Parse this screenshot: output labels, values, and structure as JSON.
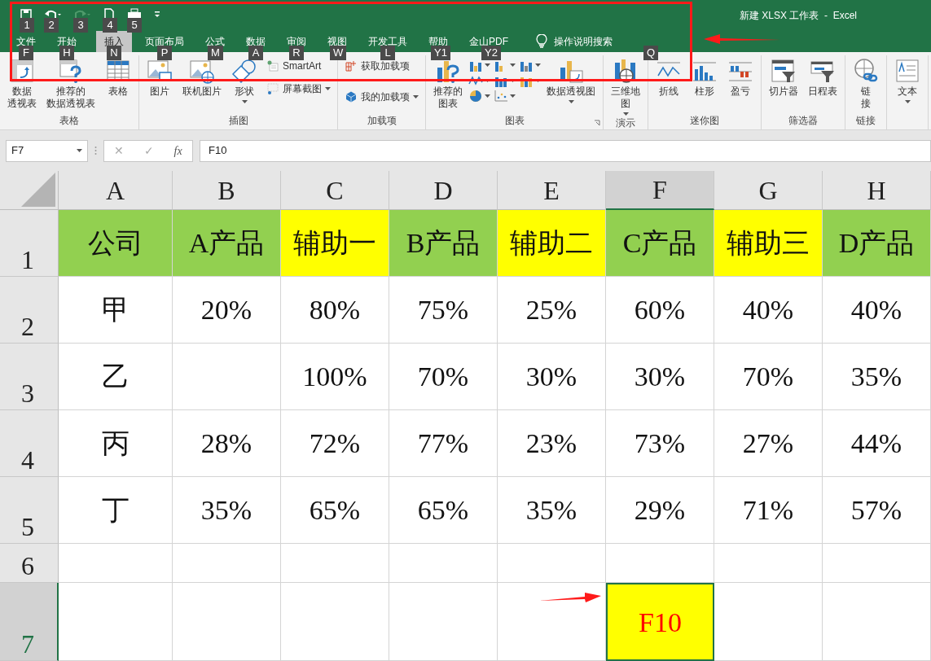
{
  "title_bar": {
    "title": "新建 XLSX 工作表  -  Excel"
  },
  "quick_access": [
    {
      "kind": "save",
      "keytip": "1",
      "disabled": false
    },
    {
      "kind": "undo",
      "keytip": "2",
      "disabled": false
    },
    {
      "kind": "redo",
      "keytip": "3",
      "disabled": true
    },
    {
      "kind": "new",
      "keytip": "4",
      "disabled": false
    },
    {
      "kind": "print",
      "keytip": "5",
      "disabled": false
    },
    {
      "kind": "customize"
    }
  ],
  "tabs": [
    {
      "label": "文件",
      "keytip": "F",
      "selected": false
    },
    {
      "label": "开始",
      "keytip": "H",
      "selected": false
    },
    {
      "label": "插入",
      "keytip": "N",
      "selected": true
    },
    {
      "label": "页面布局",
      "keytip": "P",
      "selected": false
    },
    {
      "label": "公式",
      "keytip": "M",
      "selected": false
    },
    {
      "label": "数据",
      "keytip": "A",
      "selected": false
    },
    {
      "label": "审阅",
      "keytip": "R",
      "selected": false
    },
    {
      "label": "视图",
      "keytip": "W",
      "selected": false
    },
    {
      "label": "开发工具",
      "keytip": "L",
      "selected": false
    },
    {
      "label": "帮助",
      "keytip": "Y1",
      "selected": false
    },
    {
      "label": "金山PDF",
      "keytip": "Y2",
      "selected": false
    },
    {
      "label": "操作说明搜索",
      "keytip": "Q",
      "selected": false,
      "kind": "search"
    }
  ],
  "ribbon_groups": [
    {
      "label": "表格",
      "items": [
        {
          "kind": "large",
          "lines": [
            "数据",
            "透视表"
          ]
        },
        {
          "kind": "large",
          "lines": [
            "推荐的",
            "数据透视表"
          ]
        },
        {
          "kind": "large",
          "lines": [
            "表格"
          ]
        }
      ]
    },
    {
      "label": "插图",
      "items": [
        {
          "kind": "large",
          "lines": [
            "图片"
          ]
        },
        {
          "kind": "large",
          "lines": [
            "联机图片"
          ]
        },
        {
          "kind": "large",
          "lines": [
            "形状"
          ],
          "dropdown": true
        },
        {
          "kind": "stack",
          "entries": [
            {
              "label": "SmartArt",
              "dropdown": false
            },
            {
              "label": "屏幕截图",
              "dropdown": true
            }
          ]
        }
      ]
    },
    {
      "label": "加载项",
      "items": [
        {
          "kind": "stack",
          "entries": [
            {
              "label": "获取加载项",
              "dropdown": false
            },
            {
              "label": "我的加载项",
              "dropdown": true
            }
          ]
        }
      ]
    },
    {
      "label": "图表",
      "launcher": true,
      "items": [
        {
          "kind": "large",
          "lines": [
            "推荐的",
            "图表"
          ]
        },
        {
          "kind": "chart_grid"
        },
        {
          "kind": "large",
          "lines": [
            "数据透视图"
          ],
          "dropdown": true
        }
      ]
    },
    {
      "label": "演示",
      "items": [
        {
          "kind": "large",
          "lines": [
            "三维地",
            "图"
          ],
          "dropdown": true
        }
      ]
    },
    {
      "label": "迷你图",
      "items": [
        {
          "kind": "large",
          "lines": [
            "折线"
          ]
        },
        {
          "kind": "large",
          "lines": [
            "柱形"
          ]
        },
        {
          "kind": "large",
          "lines": [
            "盈亏"
          ]
        }
      ]
    },
    {
      "label": "筛选器",
      "items": [
        {
          "kind": "large",
          "lines": [
            "切片器"
          ]
        },
        {
          "kind": "large",
          "lines": [
            "日程表"
          ]
        }
      ]
    },
    {
      "label": "链接",
      "items": [
        {
          "kind": "large",
          "lines": [
            "链",
            "接"
          ]
        }
      ]
    },
    {
      "items": [
        {
          "kind": "large",
          "lines": [
            "文本"
          ],
          "dropdown": true
        }
      ]
    }
  ],
  "formula_bar": {
    "name_box": "F7",
    "formula": "F10",
    "cancel": "✕",
    "enter": "✓",
    "fx": "fx"
  },
  "sheet": {
    "columns": [
      {
        "label": "A",
        "selected": false
      },
      {
        "label": "B",
        "selected": false
      },
      {
        "label": "C",
        "selected": false
      },
      {
        "label": "D",
        "selected": false
      },
      {
        "label": "E",
        "selected": false
      },
      {
        "label": "F",
        "selected": true
      },
      {
        "label": "G",
        "selected": false
      },
      {
        "label": "H",
        "selected": false
      }
    ],
    "rows": [
      {
        "label": "1",
        "selected": false,
        "cells": [
          {
            "text": "公司",
            "color": "#92d050"
          },
          {
            "text": "A产品",
            "color": "#92d050"
          },
          {
            "text": "辅助一",
            "color": "#ffff00"
          },
          {
            "text": "B产品",
            "color": "#92d050"
          },
          {
            "text": "辅助二",
            "color": "#ffff00"
          },
          {
            "text": "C产品",
            "color": "#92d050"
          },
          {
            "text": "辅助三",
            "color": "#ffff00"
          },
          {
            "text": "D产品",
            "color": "#92d050"
          }
        ]
      },
      {
        "label": "2",
        "selected": false,
        "cells": [
          {
            "text": "甲"
          },
          {
            "text": "20%"
          },
          {
            "text": "80%"
          },
          {
            "text": "75%"
          },
          {
            "text": "25%"
          },
          {
            "text": "60%"
          },
          {
            "text": "40%"
          },
          {
            "text": "40%"
          }
        ]
      },
      {
        "label": "3",
        "selected": false,
        "cells": [
          {
            "text": "乙"
          },
          {},
          {
            "text": "100%"
          },
          {
            "text": "70%"
          },
          {
            "text": "30%"
          },
          {
            "text": "30%"
          },
          {
            "text": "70%"
          },
          {
            "text": "35%"
          }
        ]
      },
      {
        "label": "4",
        "selected": false,
        "cells": [
          {
            "text": "丙"
          },
          {
            "text": "28%"
          },
          {
            "text": "72%"
          },
          {
            "text": "77%"
          },
          {
            "text": "23%"
          },
          {
            "text": "73%"
          },
          {
            "text": "27%"
          },
          {
            "text": "44%"
          }
        ]
      },
      {
        "label": "5",
        "selected": false,
        "cells": [
          {
            "text": "丁"
          },
          {
            "text": "35%"
          },
          {
            "text": "65%"
          },
          {
            "text": "65%"
          },
          {
            "text": "35%"
          },
          {
            "text": "29%"
          },
          {
            "text": "71%"
          },
          {
            "text": "57%"
          }
        ]
      },
      {
        "label": "6",
        "selected": false,
        "cells": [
          {},
          {},
          {},
          {},
          {},
          {},
          {},
          {}
        ]
      },
      {
        "label": "7",
        "selected": true,
        "cells": [
          {},
          {},
          {},
          {},
          {},
          {
            "text": "F10",
            "color": "#ffff00",
            "selected": true
          },
          {},
          {}
        ]
      }
    ]
  }
}
